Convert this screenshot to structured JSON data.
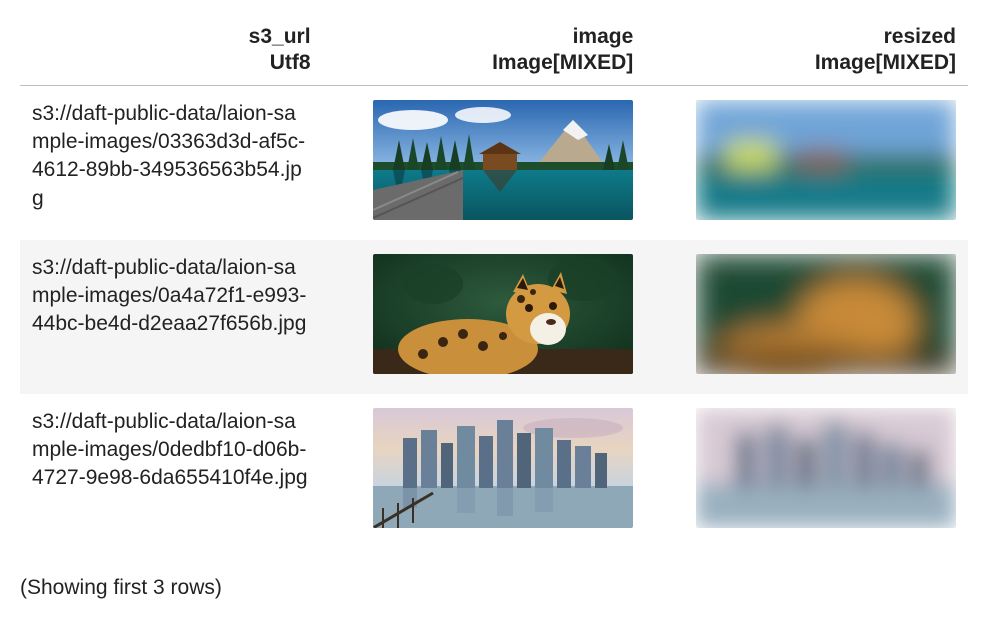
{
  "columns": [
    {
      "name": "s3_url",
      "type": "Utf8"
    },
    {
      "name": "image",
      "type": "Image[MIXED]"
    },
    {
      "name": "resized",
      "type": "Image[MIXED]"
    }
  ],
  "rows": [
    {
      "s3_url": "s3://daft-public-data/laion-sample-images/03363d3d-af5c-4612-89bb-349536563b54.jpg"
    },
    {
      "s3_url": "s3://daft-public-data/laion-sample-images/0a4a72f1-e993-44bc-be4d-d2eaa27f656b.jpg"
    },
    {
      "s3_url": "s3://daft-public-data/laion-sample-images/0dedbf10-d06b-4727-9e98-6da655410f4e.jpg"
    }
  ],
  "footer": "(Showing first 3 rows)"
}
